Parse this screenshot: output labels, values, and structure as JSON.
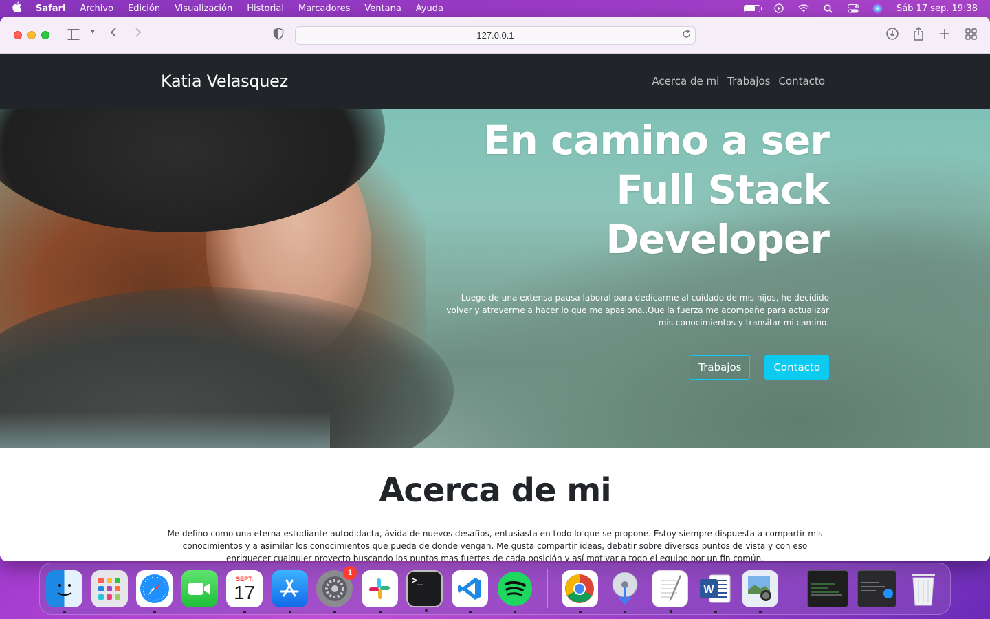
{
  "menubar": {
    "app": "Safari",
    "items": [
      "Archivo",
      "Edición",
      "Visualización",
      "Historial",
      "Marcadores",
      "Ventana",
      "Ayuda"
    ],
    "datetime": "Sáb 17 sep.  19:38",
    "battery_level": 0.75
  },
  "browser": {
    "url": "127.0.0.1"
  },
  "site": {
    "brand": "Katia Velasquez",
    "nav": [
      "Acerca de mi",
      "Trabajos",
      "Contacto"
    ],
    "hero": {
      "title_line1": "En camino a ser",
      "title_line2": "Full Stack",
      "title_line3": "Developer",
      "text": "Luego de una extensa pausa laboral para dedicarme al cuidado de mis hijos, he decidido volver y atreverme a hacer lo que me apasiona..Que la fuerza me acompañe para actualizar mis conocimientos y transitar mi camino.",
      "button_outline": "Trabajos",
      "button_primary": "Contacto"
    },
    "about": {
      "heading": "Acerca de mi",
      "text": "Me defino como una eterna estudiante autodidacta, ávida de nuevos desafíos, entusiasta en todo lo que se propone. Estoy siempre dispuesta a compartir mis conocimientos y a asimilar los conocimientos que pueda de donde vengan. Me gusta compartir ideas, debatir sobre diversos puntos de vista y con eso enriquecer cualquier proyecto buscando los puntos mas fuertes de cada posición y así motivar a todo el equipo por un fin común."
    }
  },
  "dock": {
    "calendar_month": "SEPT.",
    "calendar_day": "17",
    "settings_badge": "1",
    "apps": [
      "finder",
      "launchpad",
      "safari",
      "facetime",
      "calendar",
      "app-store",
      "system-preferences",
      "slack",
      "terminal",
      "vscode",
      "spotify",
      "chrome",
      "downloads",
      "textedit",
      "word",
      "preview",
      "window-thumb-1",
      "window-thumb-2",
      "trash"
    ]
  },
  "colors": {
    "navbar": "#212529",
    "accent": "#0dcaf0"
  }
}
